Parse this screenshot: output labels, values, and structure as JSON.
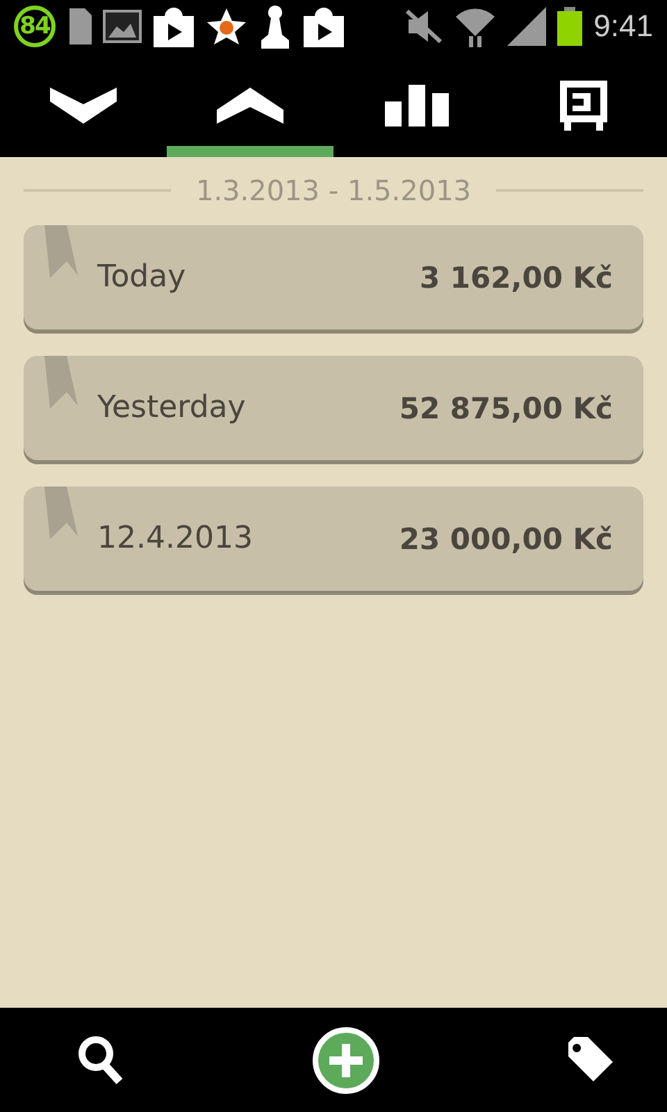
{
  "status_bar": {
    "badge": "84",
    "time": "9:41"
  },
  "tabs": [
    {
      "kind": "down",
      "selected": false
    },
    {
      "kind": "up",
      "selected": true
    },
    {
      "kind": "chart",
      "selected": false
    },
    {
      "kind": "box",
      "selected": false
    }
  ],
  "period": "1.3.2013 - 1.5.2013",
  "entries": [
    {
      "label": "Today",
      "amount": "3 162,00 Kč"
    },
    {
      "label": "Yesterday",
      "amount": "52 875,00 Kč"
    },
    {
      "label": "12.4.2013",
      "amount": "23 000,00 Kč"
    }
  ],
  "bottom_bar": [
    {
      "kind": "search"
    },
    {
      "kind": "add"
    },
    {
      "kind": "tag"
    }
  ]
}
